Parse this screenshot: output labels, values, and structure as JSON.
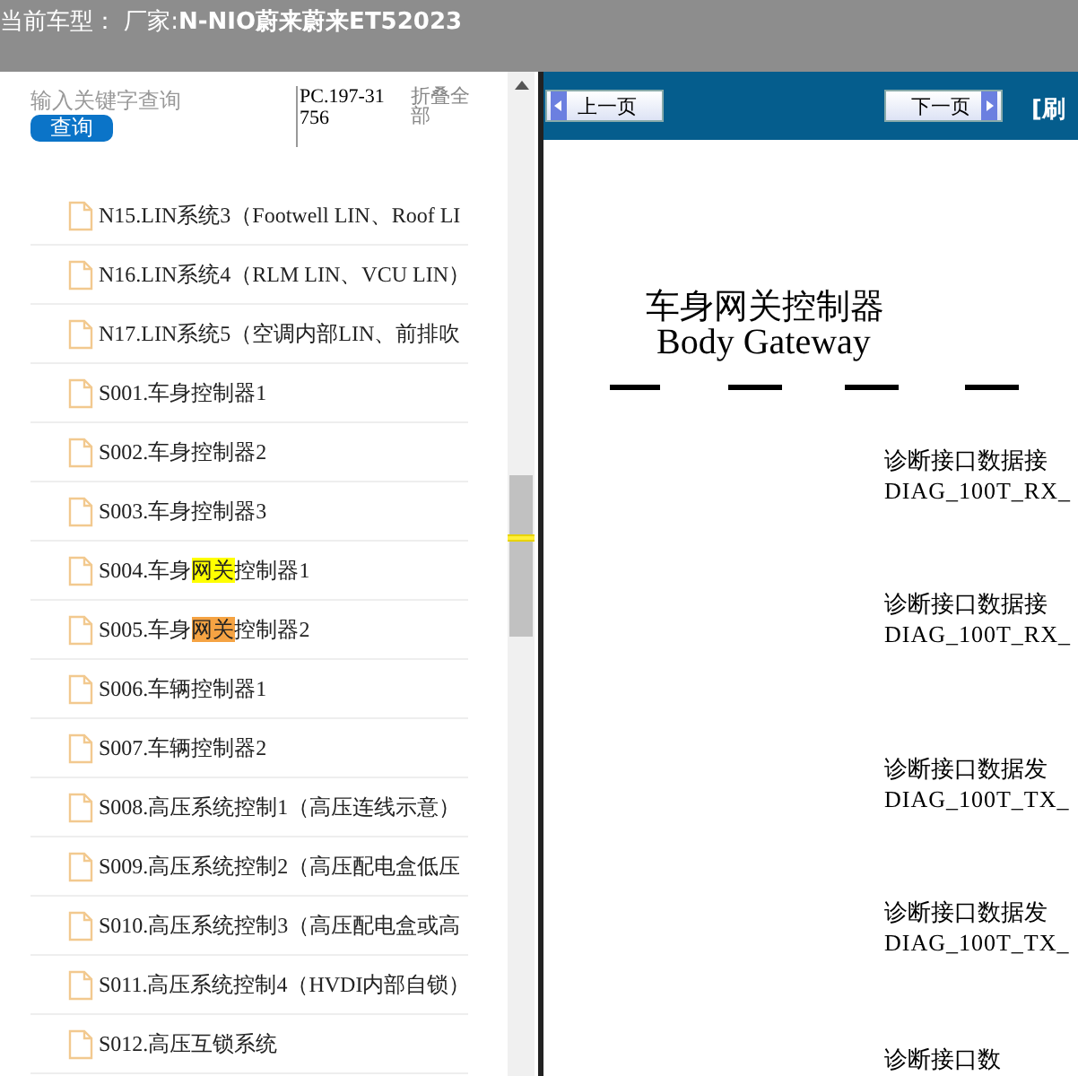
{
  "header": {
    "title": "当前车型： 厂家:**N-NIO蔚来蔚来ET52023**"
  },
  "sidebar": {
    "search": {
      "placeholder": "输入关键字查询",
      "button": "查询"
    },
    "code": "PC.197-31756",
    "collapse_all": "折叠全部",
    "items": [
      {
        "segments": [
          {
            "text": "N15.LIN系统3（Footwell LIN、Roof LI"
          }
        ]
      },
      {
        "segments": [
          {
            "text": "N16.LIN系统4（RLM LIN、VCU LIN）"
          }
        ]
      },
      {
        "segments": [
          {
            "text": "N17.LIN系统5（空调内部LIN、前排吹"
          }
        ]
      },
      {
        "segments": [
          {
            "text": "S001.车身控制器1"
          }
        ]
      },
      {
        "segments": [
          {
            "text": "S002.车身控制器2"
          }
        ]
      },
      {
        "segments": [
          {
            "text": "S003.车身控制器3"
          }
        ]
      },
      {
        "segments": [
          {
            "text": "S004.车身"
          },
          {
            "text": "网关",
            "highlighted": true,
            "current": false
          },
          {
            "text": "控制器1"
          }
        ]
      },
      {
        "segments": [
          {
            "text": "S005.车身"
          },
          {
            "text": "网关",
            "highlighted": true,
            "current": true
          },
          {
            "text": "控制器2"
          }
        ]
      },
      {
        "segments": [
          {
            "text": "S006.车辆控制器1"
          }
        ]
      },
      {
        "segments": [
          {
            "text": "S007.车辆控制器2"
          }
        ]
      },
      {
        "segments": [
          {
            "text": "S008.高压系统控制1（高压连线示意）"
          }
        ]
      },
      {
        "segments": [
          {
            "text": "S009.高压系统控制2（高压配电盒低压"
          }
        ]
      },
      {
        "segments": [
          {
            "text": "S010.高压系统控制3（高压配电盒或高"
          }
        ]
      },
      {
        "segments": [
          {
            "text": "S011.高压系统控制4（HVDI内部自锁）"
          }
        ]
      },
      {
        "segments": [
          {
            "text": "S012.高压互锁系统"
          }
        ]
      }
    ]
  },
  "toolbar": {
    "prev": "上一页",
    "next": "下一页",
    "refresh": "[刷"
  },
  "document": {
    "title_cn": "车身网关控制器",
    "title_en": "Body Gateway",
    "signals": [
      {
        "name": "诊断接口数据接",
        "code": "DIAG_100T_RX_"
      },
      {
        "name": "诊断接口数据接",
        "code": "DIAG_100T_RX_"
      },
      {
        "name": "诊断接口数据发",
        "code": "DIAG_100T_TX_"
      },
      {
        "name": "诊断接口数据发",
        "code": "DIAG_100T_TX_"
      },
      {
        "name": "诊断接口数"
      }
    ]
  }
}
